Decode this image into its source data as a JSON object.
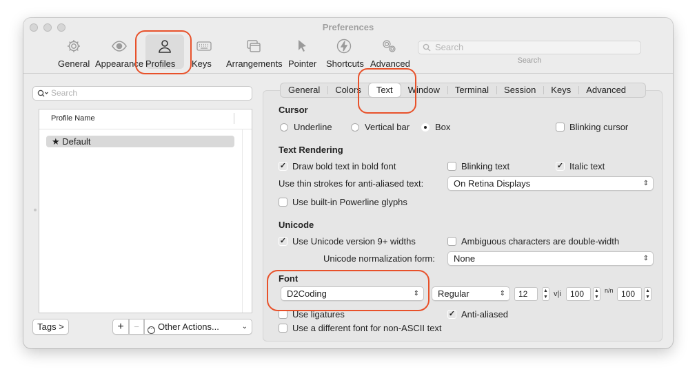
{
  "window": {
    "title": "Preferences"
  },
  "toolbar": {
    "items": [
      {
        "label": "General",
        "icon": "gear-icon"
      },
      {
        "label": "Appearance",
        "icon": "eye-icon"
      },
      {
        "label": "Profiles",
        "icon": "person-icon"
      },
      {
        "label": "Keys",
        "icon": "keyboard-icon"
      },
      {
        "label": "Arrangements",
        "icon": "windows-icon"
      },
      {
        "label": "Pointer",
        "icon": "pointer-icon"
      },
      {
        "label": "Shortcuts",
        "icon": "bolt-icon"
      },
      {
        "label": "Advanced",
        "icon": "gears-icon"
      }
    ],
    "search_placeholder": "Search",
    "search_label": "Search"
  },
  "sidebar": {
    "search_placeholder": "Search",
    "column_header": "Profile Name",
    "profiles": [
      {
        "name": "Default",
        "marker": "★"
      }
    ],
    "tags_button": "Tags >",
    "add_button": "+",
    "remove_button": "−",
    "other_actions": "Other Actions..."
  },
  "tabs": [
    "General",
    "Colors",
    "Text",
    "Window",
    "Terminal",
    "Session",
    "Keys",
    "Advanced"
  ],
  "cursor": {
    "heading": "Cursor",
    "underline": "Underline",
    "vertical_bar": "Vertical bar",
    "box": "Box",
    "blinking": "Blinking cursor"
  },
  "rendering": {
    "heading": "Text Rendering",
    "draw_bold": "Draw bold text in bold font",
    "blinking_text": "Blinking text",
    "italic_text": "Italic text",
    "thin_strokes_label": "Use thin strokes for anti-aliased text:",
    "thin_strokes_value": "On Retina Displays",
    "powerline": "Use built-in Powerline glyphs"
  },
  "unicode": {
    "heading": "Unicode",
    "version9": "Use Unicode version 9+ widths",
    "ambiguous": "Ambiguous characters are double-width",
    "normalization_label": "Unicode normalization form:",
    "normalization_value": "None"
  },
  "font": {
    "heading": "Font",
    "family": "D2Coding",
    "style": "Regular",
    "size": "12",
    "h_spacing_glyph": "v|i",
    "h_spacing": "100",
    "v_spacing_glyph": "n/n",
    "v_spacing": "100",
    "ligatures": "Use ligatures",
    "anti_aliased": "Anti-aliased",
    "non_ascii": "Use a different font for non-ASCII text"
  },
  "colors": {
    "highlight": "#e8512a",
    "window_bg": "#ececec"
  }
}
